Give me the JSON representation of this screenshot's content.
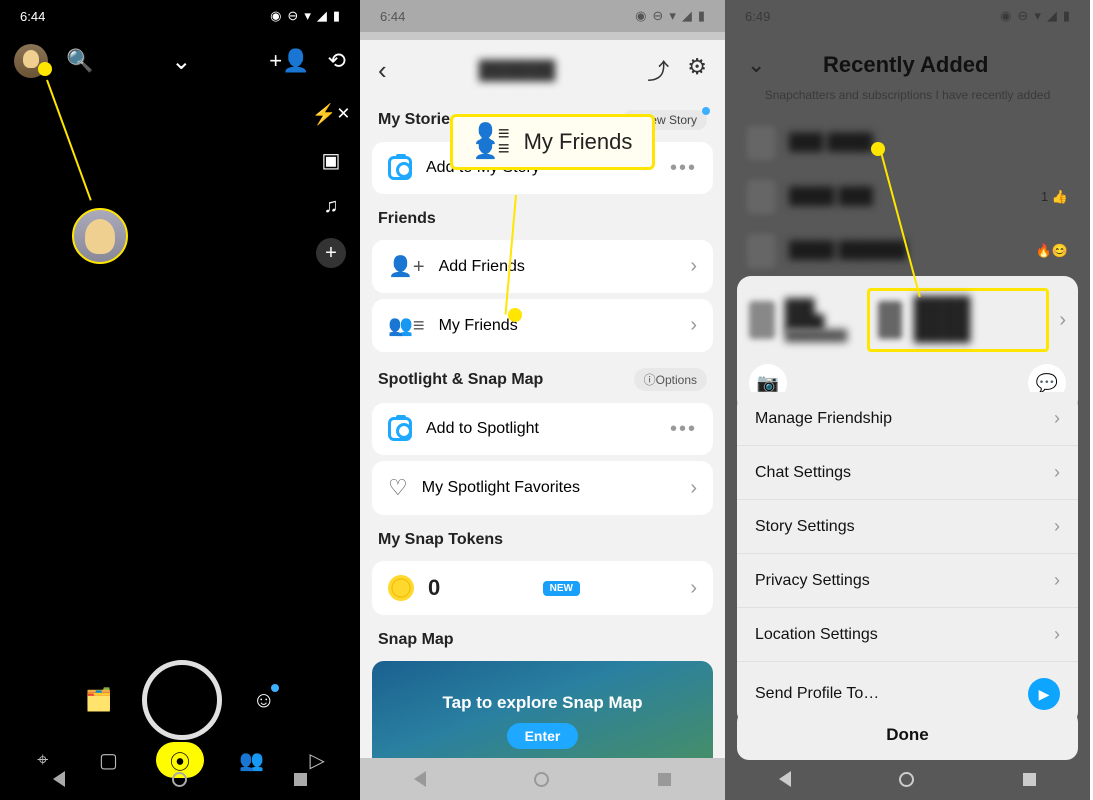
{
  "s1": {
    "time": "6:44",
    "status_icons": [
      "vibrate",
      "dnd",
      "wifi",
      "signal",
      "battery"
    ],
    "rail": [
      "flash-off",
      "video",
      "music",
      "add"
    ],
    "tabs": [
      "location",
      "chat",
      "camera",
      "friends",
      "play"
    ]
  },
  "s2": {
    "time": "6:44",
    "username": "██████",
    "sections": {
      "my_stories": "My Stories",
      "new_story": "New Story",
      "add_to_story": "Add to My Story",
      "friends": "Friends",
      "add_friends": "Add Friends",
      "my_friends": "My Friends",
      "spotlight": "Spotlight & Snap Map",
      "options": "Options",
      "add_spotlight": "Add to Spotlight",
      "spotlight_favs": "My Spotlight Favorites",
      "snap_tokens": "My Snap Tokens",
      "token_count": "0",
      "new_badge": "NEW",
      "snap_map": "Snap Map",
      "map_text": "Tap to explore Snap Map",
      "enter": "Enter"
    },
    "callout": "My Friends"
  },
  "s3": {
    "time": "6:49",
    "title": "Recently Added",
    "subtitle": "Snapchatters and subscriptions I have recently added",
    "friends": [
      {
        "name": "███ ████",
        "badge": ""
      },
      {
        "name": "████ ███",
        "badge": "1 👍"
      },
      {
        "name": "████ ██████",
        "badge": "🔥😊"
      },
      {
        "name": "███ ████",
        "badge": ""
      }
    ],
    "profile_name": "███ ████",
    "profile_big": "████ ████",
    "settings": [
      "Manage Friendship",
      "Chat Settings",
      "Story Settings",
      "Privacy Settings",
      "Location Settings",
      "Send Profile To…"
    ],
    "done": "Done"
  }
}
